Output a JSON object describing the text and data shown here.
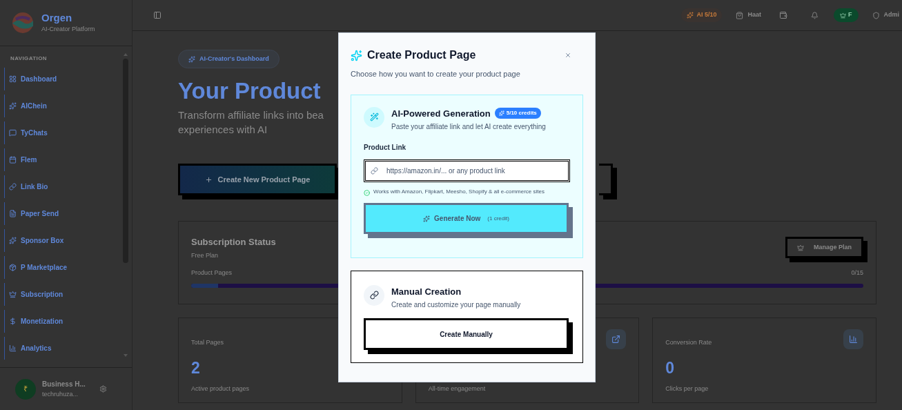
{
  "sidebar": {
    "brand": {
      "name": "Orgen",
      "tagline": "AI-Creator Platform"
    },
    "section_label": "NAVIGATION",
    "items": [
      {
        "label": "Dashboard"
      },
      {
        "label": "AIChein"
      },
      {
        "label": "TyChats"
      },
      {
        "label": "Flem"
      },
      {
        "label": "Link Bio"
      },
      {
        "label": "Paper Send"
      },
      {
        "label": "Sponsor Box"
      },
      {
        "label": "P Marketplace"
      },
      {
        "label": "Subscription"
      },
      {
        "label": "Monetization"
      },
      {
        "label": "Analytics"
      }
    ],
    "user": {
      "name": "Business H...",
      "email": "techruhuza...",
      "avatar_symbol": "₹"
    }
  },
  "header": {
    "ai_credits": "AI 5/10",
    "shop": "Haat",
    "plan_badge": "F",
    "account": "Admi"
  },
  "main": {
    "badge": "AI-Creator's Dashboard",
    "title": "Your Product",
    "subtitle_lines": [
      "Transform affiliate links into bea",
      "experiences with AI"
    ],
    "primary_button": "Create New Product Page",
    "subscription": {
      "title": "Subscription Status",
      "plan": "Free Plan",
      "manage_button": "Manage Plan",
      "usage_label": "Product Pages",
      "usage_count": "0/15",
      "level": 0.04
    },
    "stats": [
      {
        "title": "Total Pages",
        "value": "2",
        "caption": "Active product pages"
      },
      {
        "caption": "All-time engagement"
      },
      {
        "title": "Conversion Rate",
        "value": "0",
        "caption": "Clicks per page"
      }
    ]
  },
  "modal": {
    "title": "Create Product Page",
    "subtitle": "Choose how you want to create your product page",
    "ai": {
      "title": "AI-Powered Generation",
      "credits_badge": "5/10 credits",
      "description": "Paste your affiliate link and let AI create everything",
      "field_label": "Product Link",
      "placeholder": "https://amazon.in/... or any product link",
      "hint": "Works with Amazon, Flipkart, Meesho, Shopify & all e-commerce sites",
      "button": "Generate Now",
      "button_note": "(1 credit)",
      "button_disabled": true
    },
    "manual": {
      "title": "Manual Creation",
      "description": "Create and customize your page manually",
      "button": "Create Manually"
    }
  }
}
